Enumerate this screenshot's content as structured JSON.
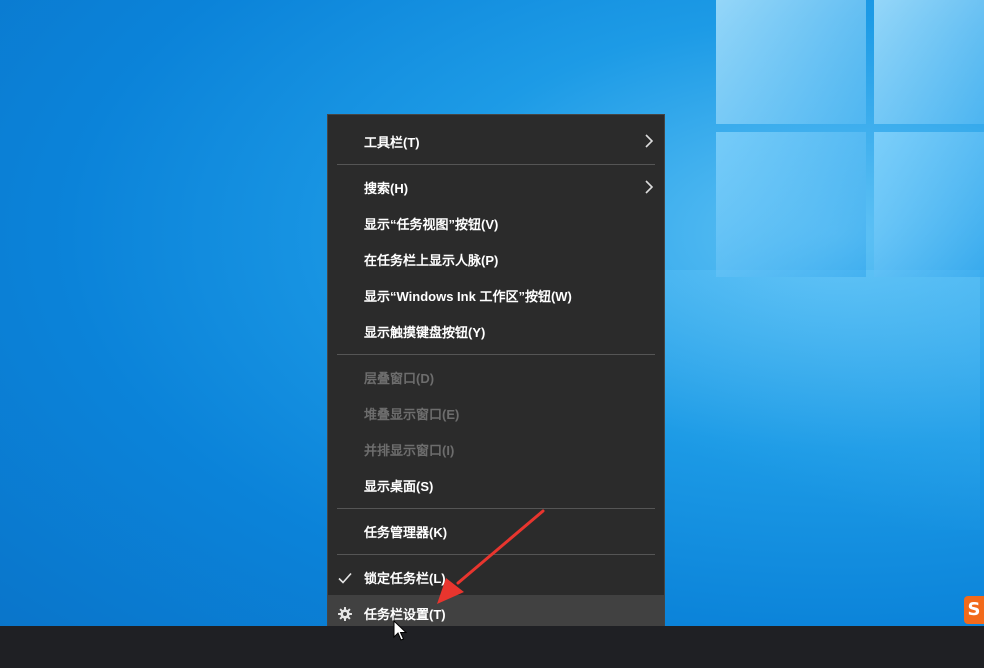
{
  "menu": {
    "toolbars": "工具栏(T)",
    "search": "搜索(H)",
    "show_task_view": "显示“任务视图”按钮(V)",
    "show_people": "在任务栏上显示人脉(P)",
    "show_ink": "显示“Windows Ink 工作区”按钮(W)",
    "show_touch_keyboard": "显示触摸键盘按钮(Y)",
    "cascade": "层叠窗口(D)",
    "stack": "堆叠显示窗口(E)",
    "side_by_side": "并排显示窗口(I)",
    "show_desktop": "显示桌面(S)",
    "task_manager": "任务管理器(K)",
    "lock_taskbar": "锁定任务栏(L)",
    "taskbar_settings": "任务栏设置(T)"
  },
  "state": {
    "lock_taskbar_checked": true,
    "hovered_item": "taskbar_settings"
  },
  "icons": {
    "submenu": "chevron-right-icon",
    "check": "checkmark-icon",
    "settings": "gear-icon"
  },
  "watermark": {
    "text": "S",
    "color": "#f26a1b"
  },
  "colors": {
    "menu_bg": "#2b2b2b",
    "menu_hover": "#414141",
    "text": "#ffffff",
    "disabled_text": "#6d6d6d",
    "annotation_arrow": "#e8352e",
    "taskbar": "#1f2024"
  }
}
